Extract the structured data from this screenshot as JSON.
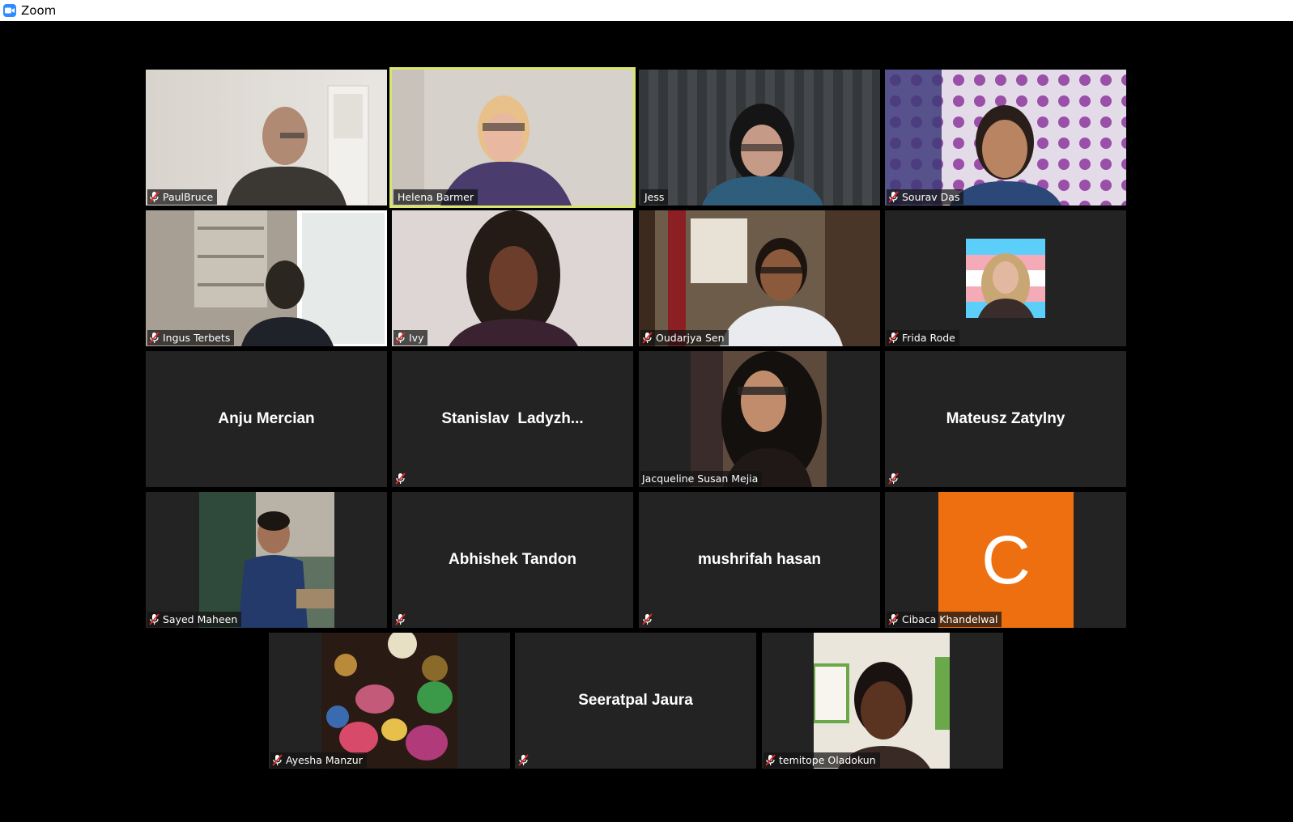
{
  "window": {
    "title": "Zoom"
  },
  "participants": [
    {
      "name": "PaulBruce",
      "muted": true,
      "mode": "video"
    },
    {
      "name": "Helena Barmer",
      "muted": false,
      "mode": "video",
      "active_speaker": true
    },
    {
      "name": "Jess",
      "muted": false,
      "mode": "video"
    },
    {
      "name": "Sourav Das",
      "muted": true,
      "mode": "video"
    },
    {
      "name": "Ingus Terbets",
      "muted": true,
      "mode": "video"
    },
    {
      "name": "Ivy",
      "muted": true,
      "mode": "video"
    },
    {
      "name": "Oudarjya Sen",
      "muted": true,
      "mode": "video"
    },
    {
      "name": "Frida Rode",
      "muted": true,
      "mode": "photo"
    },
    {
      "name": "Anju Mercian",
      "muted": false,
      "mode": "name"
    },
    {
      "name": "Stanislav  Ladyzh...",
      "muted": true,
      "mode": "name"
    },
    {
      "name": "Jacqueline Susan Mejia",
      "muted": false,
      "mode": "photo"
    },
    {
      "name": "Mateusz Zatylny",
      "muted": true,
      "mode": "name"
    },
    {
      "name": "Sayed Maheen",
      "muted": true,
      "mode": "photo"
    },
    {
      "name": "Abhishek Tandon",
      "muted": true,
      "mode": "name"
    },
    {
      "name": "mushrifah hasan",
      "muted": true,
      "mode": "name"
    },
    {
      "name": "Cibaca Khandelwal",
      "muted": true,
      "mode": "avatar",
      "avatar_letter": "C",
      "avatar_color": "#ee6f0f"
    },
    {
      "name": "Ayesha Manzur",
      "muted": true,
      "mode": "photo"
    },
    {
      "name": "Seeratpal Jaura",
      "muted": true,
      "mode": "name"
    },
    {
      "name": "temitope Oladokun",
      "muted": true,
      "mode": "photo"
    }
  ],
  "colors": {
    "active_speaker_border": "#d9e56a",
    "tile_background": "#232323",
    "mute_red": "#e02828"
  }
}
